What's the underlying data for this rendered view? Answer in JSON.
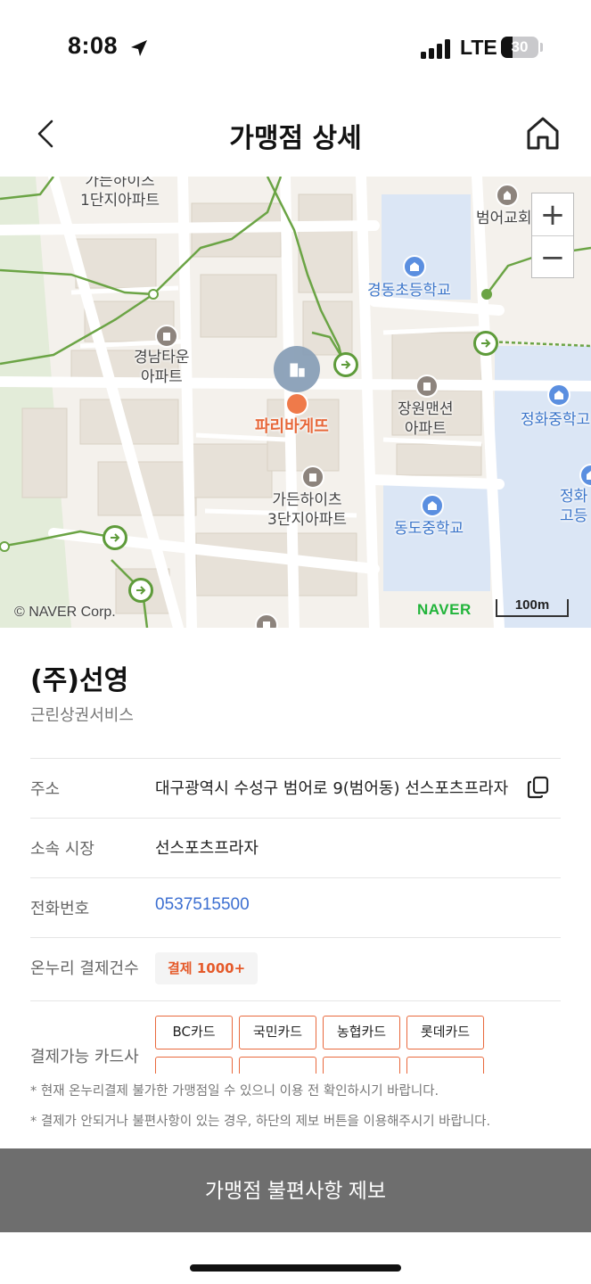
{
  "status_bar": {
    "time": "8:08",
    "network": "LTE",
    "battery": "30",
    "battery_level": 0.3
  },
  "header": {
    "back_icon": "chevron-left-icon",
    "title": "가맹점 상세",
    "home_icon": "home-icon"
  },
  "map": {
    "labels": {
      "gardenhills1": "가든하이츠\n1단지아파트",
      "gyeongnam": "경남타운\n아파트",
      "paris": "파리바게뜨",
      "gardenhills3": "가든하이츠\n3단지아파트",
      "gyeongdong": "경동초등학교",
      "jangwon": "장원맨션\n아파트",
      "dongdo": "동도중학교",
      "jeonghwa_mid": "정화중학고",
      "jeonghwa_high": "정화\n고등",
      "beomeo_church": "범어교회"
    },
    "zoom_in": "+",
    "zoom_out": "−",
    "copyright": "© NAVER Corp.",
    "logo": "NAVER",
    "scale": "100m",
    "colors": {
      "park_line": "#5e9b3a",
      "school_area": "#dbe6f5",
      "block": "#e8e2d9",
      "road": "#ffffff"
    }
  },
  "store": {
    "name": "(주)선영",
    "category": "근린상권서비스"
  },
  "info": {
    "address_label": "주소",
    "address_value": "대구광역시 수성구 범어로 9(범어동) 선스포츠프라자",
    "copy_icon": "copy-icon",
    "market_label": "소속 시장",
    "market_value": "선스포츠프라자",
    "phone_label": "전화번호",
    "phone_value": "0537515500",
    "payment_label": "온누리 결제건수",
    "payment_badge": "결제 1000+",
    "cards_label": "결제가능 카드사",
    "cards": [
      "BC카드",
      "국민카드",
      "농협카드",
      "롯데카드",
      "",
      "",
      "",
      ""
    ]
  },
  "notices": [
    "* 현재 온누리결제 불가한 가맹점일 수 있으니 이용 전 확인하시기 바랍니다.",
    "* 결제가 안되거나 불편사항이 있는 경우, 하단의 제보 버튼을 이용해주시기 바랍니다."
  ],
  "report_button": "가맹점 불편사항 제보"
}
